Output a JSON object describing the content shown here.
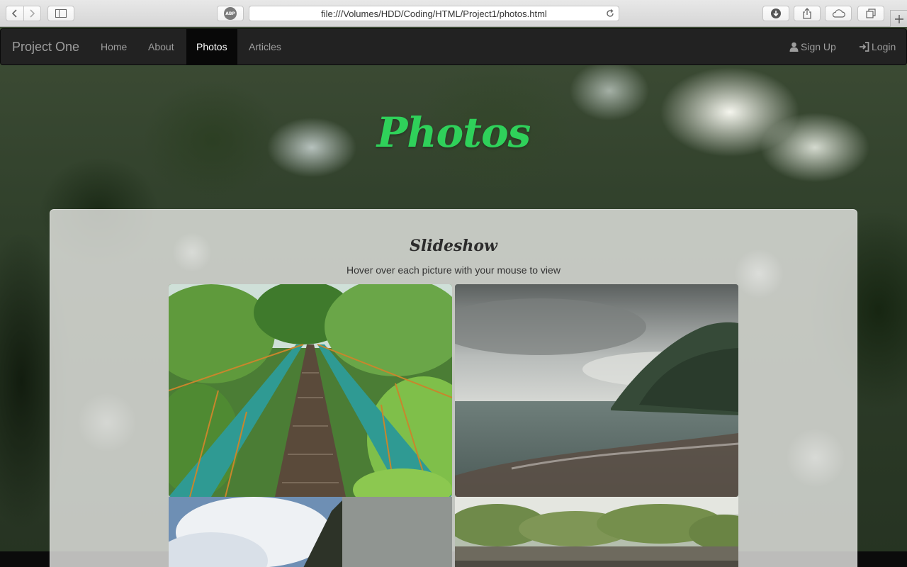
{
  "browser": {
    "url": "file:///Volumes/HDD/Coding/HTML/Project1/photos.html",
    "adblock_label": "ABP"
  },
  "navbar": {
    "brand": "Project One",
    "items": [
      {
        "label": "Home",
        "active": false
      },
      {
        "label": "About",
        "active": false
      },
      {
        "label": "Photos",
        "active": true
      },
      {
        "label": "Articles",
        "active": false
      }
    ],
    "right": {
      "signup": "Sign Up",
      "login": "Login"
    }
  },
  "page": {
    "heading": "Photos",
    "heading_color": "#2fd15a"
  },
  "slideshow": {
    "title": "Slideshow",
    "subtitle": "Hover over each picture with your mouse to view",
    "photos": [
      {
        "subject": "suspension-bridge-jungle"
      },
      {
        "subject": "ocean-cloudy-coast"
      },
      {
        "subject": "sky-clouds-cliff"
      },
      {
        "subject": "tree-canopy-cliff"
      }
    ]
  }
}
